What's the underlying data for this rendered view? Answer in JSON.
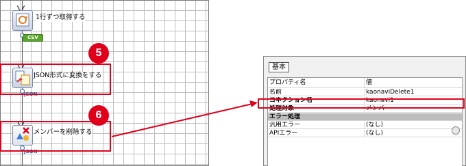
{
  "flow": {
    "nodes": [
      {
        "label": "1行ずつ取得する",
        "tag": "CSV"
      },
      {
        "label": "JSON形式に変換をする",
        "tag": "JSON"
      },
      {
        "label": "メンバーを削除する",
        "tag": "JSON"
      }
    ],
    "badges": [
      "5",
      "6"
    ]
  },
  "panel": {
    "tab_label": "基本",
    "columns": [
      "プロパティ名",
      "値"
    ],
    "rows": [
      {
        "name": "名前",
        "value": "kaonaviDelete1"
      },
      {
        "name": "コネクション名",
        "value": "kaonavi1"
      },
      {
        "name": "処理対象",
        "value": "メンバー"
      },
      {
        "name": "エラー処理",
        "value": ""
      },
      {
        "name": "汎用エラー",
        "value": "(なし)"
      },
      {
        "name": "APIエラー",
        "value": "(なし)"
      }
    ]
  },
  "colors": {
    "highlight": "#e0001b",
    "csv_tag": "#59a52e",
    "json_tag": "#1f4e96"
  }
}
